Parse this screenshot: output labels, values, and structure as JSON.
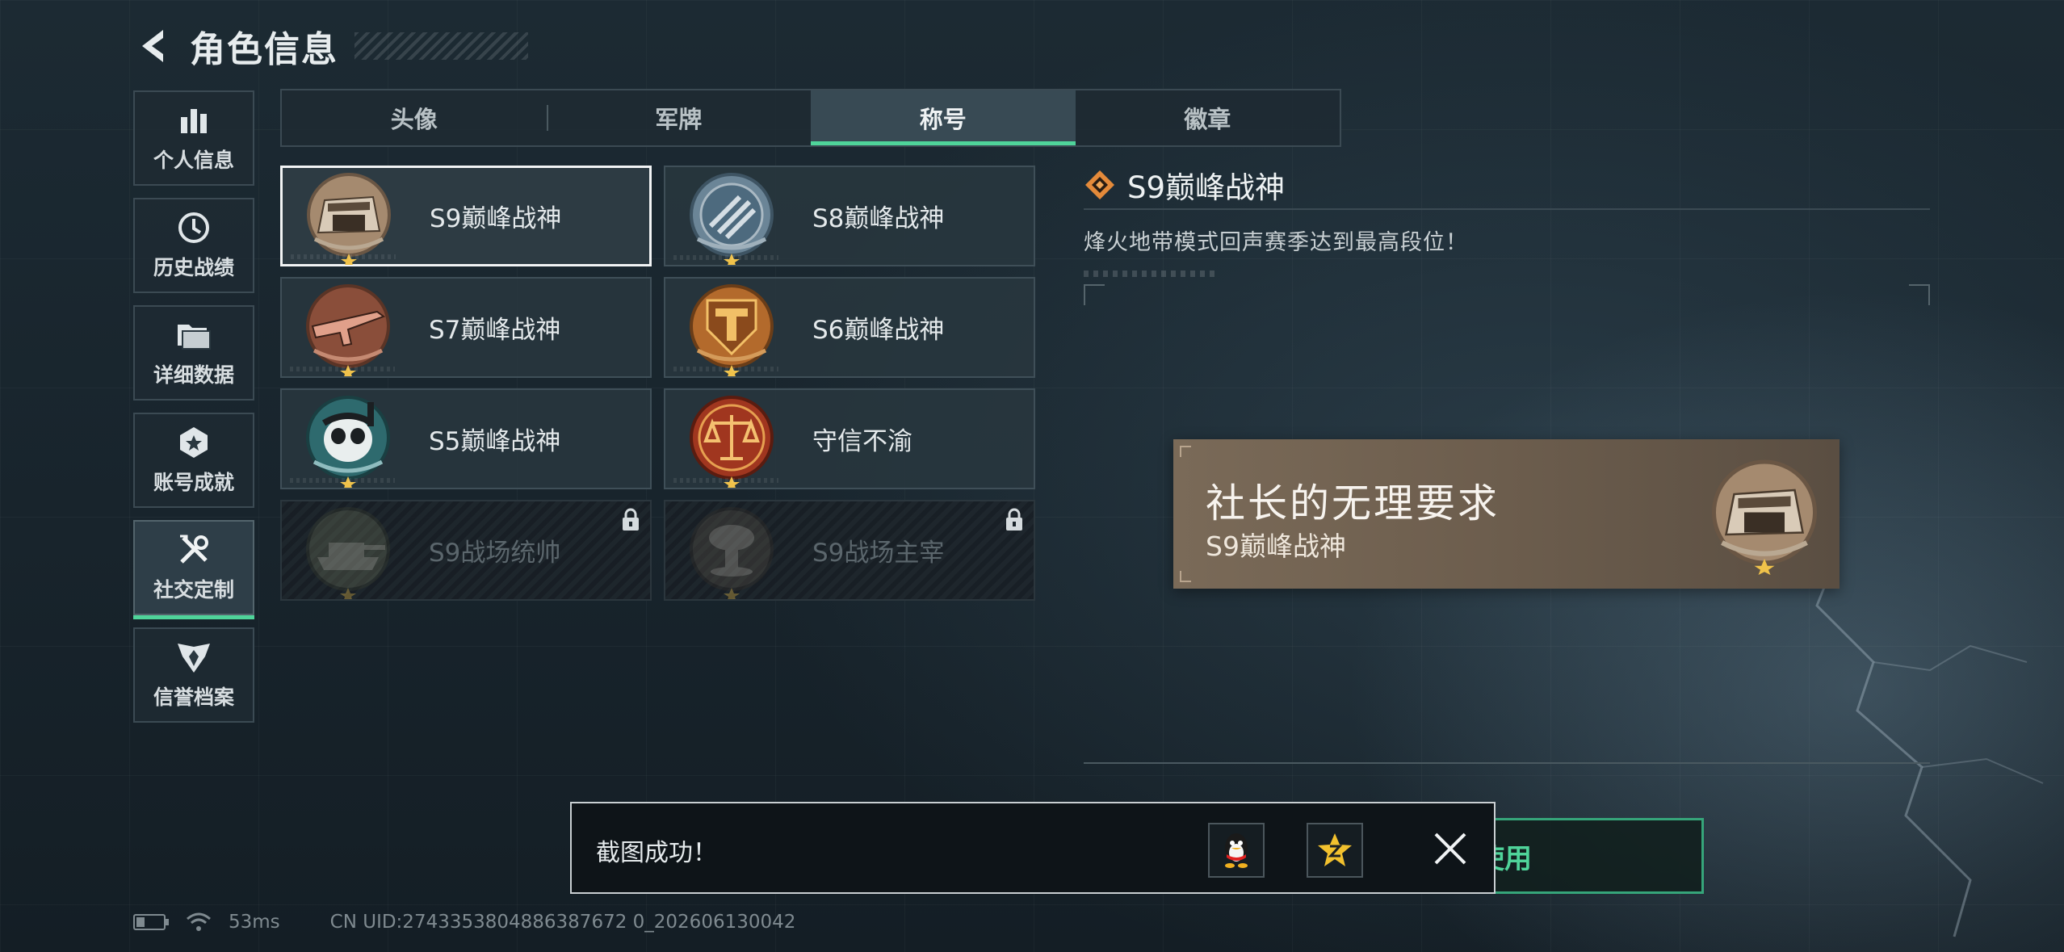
{
  "header": {
    "title": "角色信息",
    "back_icon": "chevron-left-icon"
  },
  "sidebar": {
    "items": [
      {
        "label": "个人信息",
        "icon": "bar-chart-icon",
        "active": false
      },
      {
        "label": "历史战绩",
        "icon": "clock-icon",
        "active": false
      },
      {
        "label": "详细数据",
        "icon": "folder-icon",
        "active": false
      },
      {
        "label": "账号成就",
        "icon": "badge-icon",
        "active": false
      },
      {
        "label": "社交定制",
        "icon": "tools-icon",
        "active": true
      },
      {
        "label": "信誉档案",
        "icon": "shield-wings-icon",
        "active": false
      }
    ]
  },
  "tabs": [
    {
      "label": "头像",
      "active": false
    },
    {
      "label": "军牌",
      "active": false
    },
    {
      "label": "称号",
      "active": true
    },
    {
      "label": "徽章",
      "active": false
    }
  ],
  "titles": [
    {
      "name": "S9巅峰战神",
      "emblem": "fortress-emblem-icon",
      "selected": true,
      "locked": false
    },
    {
      "name": "S8巅峰战神",
      "emblem": "blue-stripes-emblem-icon",
      "selected": false,
      "locked": false
    },
    {
      "name": "S7巅峰战神",
      "emblem": "rifle-emblem-icon",
      "selected": false,
      "locked": false
    },
    {
      "name": "S6巅峰战神",
      "emblem": "gold-t-emblem-icon",
      "selected": false,
      "locked": false
    },
    {
      "name": "S5巅峰战神",
      "emblem": "diver-skull-emblem-icon",
      "selected": false,
      "locked": false
    },
    {
      "name": "守信不渝",
      "emblem": "scales-emblem-icon",
      "selected": false,
      "locked": false
    },
    {
      "name": "S9战场统帅",
      "emblem": "tank-emblem-icon",
      "selected": false,
      "locked": true
    },
    {
      "name": "S9战场主宰",
      "emblem": "mushroom-cloud-emblem-icon",
      "selected": false,
      "locked": true
    }
  ],
  "detail": {
    "title": "S9巅峰战神",
    "description": "烽火地带模式回声赛季达到最高段位！"
  },
  "nameplate": {
    "player_name": "社长的无理要求",
    "title": "S9巅峰战神"
  },
  "use_button": {
    "label": "使用"
  },
  "toast": {
    "message": "截图成功！",
    "share_icons": [
      "qq-penguin-icon",
      "qzone-star-icon"
    ]
  },
  "status_bar": {
    "latency": "53ms",
    "uid": "CN UID:2743353804886387672 0_202606130042"
  },
  "colors": {
    "accent": "#4fd49a",
    "background": "#1c2a33",
    "nameplate": "#6c5d4d",
    "selected_border": "#f2f4f5"
  }
}
